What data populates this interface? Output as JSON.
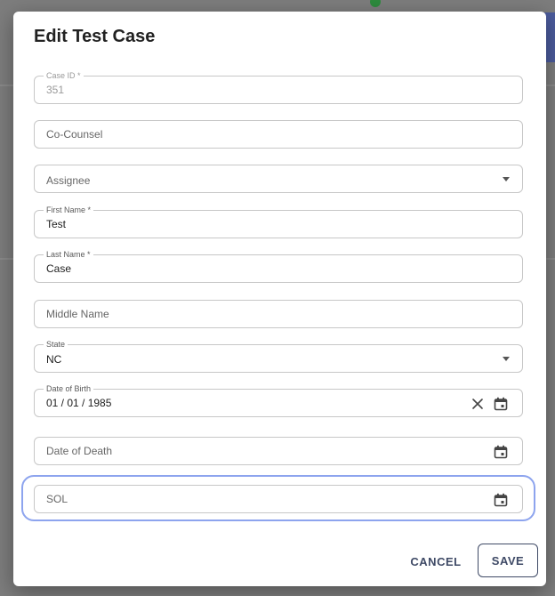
{
  "dialog": {
    "title": "Edit Test Case",
    "fields": {
      "case_id": {
        "label": "Case ID *",
        "value": "351"
      },
      "co_counsel": {
        "placeholder": "Co-Counsel",
        "value": ""
      },
      "assignee": {
        "placeholder": "Assignee"
      },
      "first_name": {
        "label": "First Name *",
        "value": "Test"
      },
      "last_name": {
        "label": "Last Name *",
        "value": "Case"
      },
      "middle_name": {
        "placeholder": "Middle Name",
        "value": ""
      },
      "state": {
        "label": "State",
        "value": "NC"
      },
      "date_of_birth": {
        "label": "Date of Birth",
        "value": "01 / 01 / 1985"
      },
      "date_of_death": {
        "placeholder": "Date of Death",
        "value": ""
      },
      "sol": {
        "placeholder": "SOL",
        "value": ""
      }
    },
    "actions": {
      "cancel_label": "CANCEL",
      "save_label": "SAVE"
    }
  },
  "icons": {
    "calendar": "calendar-icon",
    "clear": "close-icon",
    "dropdown": "chevron-down-icon"
  },
  "colors": {
    "accent": "#3f4a66",
    "focus": "#8da4ee",
    "border": "#c7c7c7"
  }
}
